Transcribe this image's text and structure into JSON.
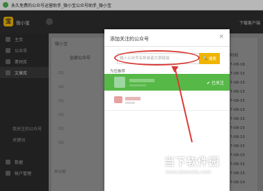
{
  "window": {
    "title": "永久免费的公众号运营助手_微小宝公众号助手_微小宝"
  },
  "app": {
    "name": "微小宝",
    "user": "",
    "download_label": "下载客户端"
  },
  "sidebar": {
    "items": [
      {
        "label": "主页"
      },
      {
        "label": "公众号"
      },
      {
        "label": "素材库"
      },
      {
        "label": "文章库"
      },
      {
        "label": ""
      },
      {
        "label": ""
      },
      {
        "label": ""
      },
      {
        "label": ""
      },
      {
        "label": "我关注的公众号"
      },
      {
        "label": "关键词"
      },
      {
        "label": ""
      },
      {
        "label": "数据"
      },
      {
        "label": "帐户管理"
      }
    ]
  },
  "main": {
    "tab": "微小宝",
    "all_label": "全部公众号",
    "right_header": "最新时间",
    "right_values": [
      "2017-08-16",
      "2017-08-15",
      "2017-08-15",
      "2017-08-15",
      "2017-08-15",
      "2017-08-15",
      "2017-08-15",
      "2017-08-15",
      "2017-08-15",
      "2017-08-15",
      "2017-08-15",
      "2017-08-15",
      "2017-08-15",
      "2017-08-14"
    ],
    "counts": [
      "(1)",
      "(1)",
      "(1)",
      "(1)",
      "(1)",
      "(1)"
    ],
    "pagination": "共分组"
  },
  "modal": {
    "title": "添加关注的公众号",
    "close": "×",
    "search_placeholder": "输入公众号名称或者文章链接",
    "search_button": "搜索",
    "rec_label": "为您推荐",
    "followed_label": "已关注"
  },
  "watermark": {
    "cn": "当下软件园",
    "url": "www.downxia.com"
  },
  "colors": {
    "accent": "#f0b400",
    "followed": "#56b846",
    "highlight": "#d93a36"
  }
}
